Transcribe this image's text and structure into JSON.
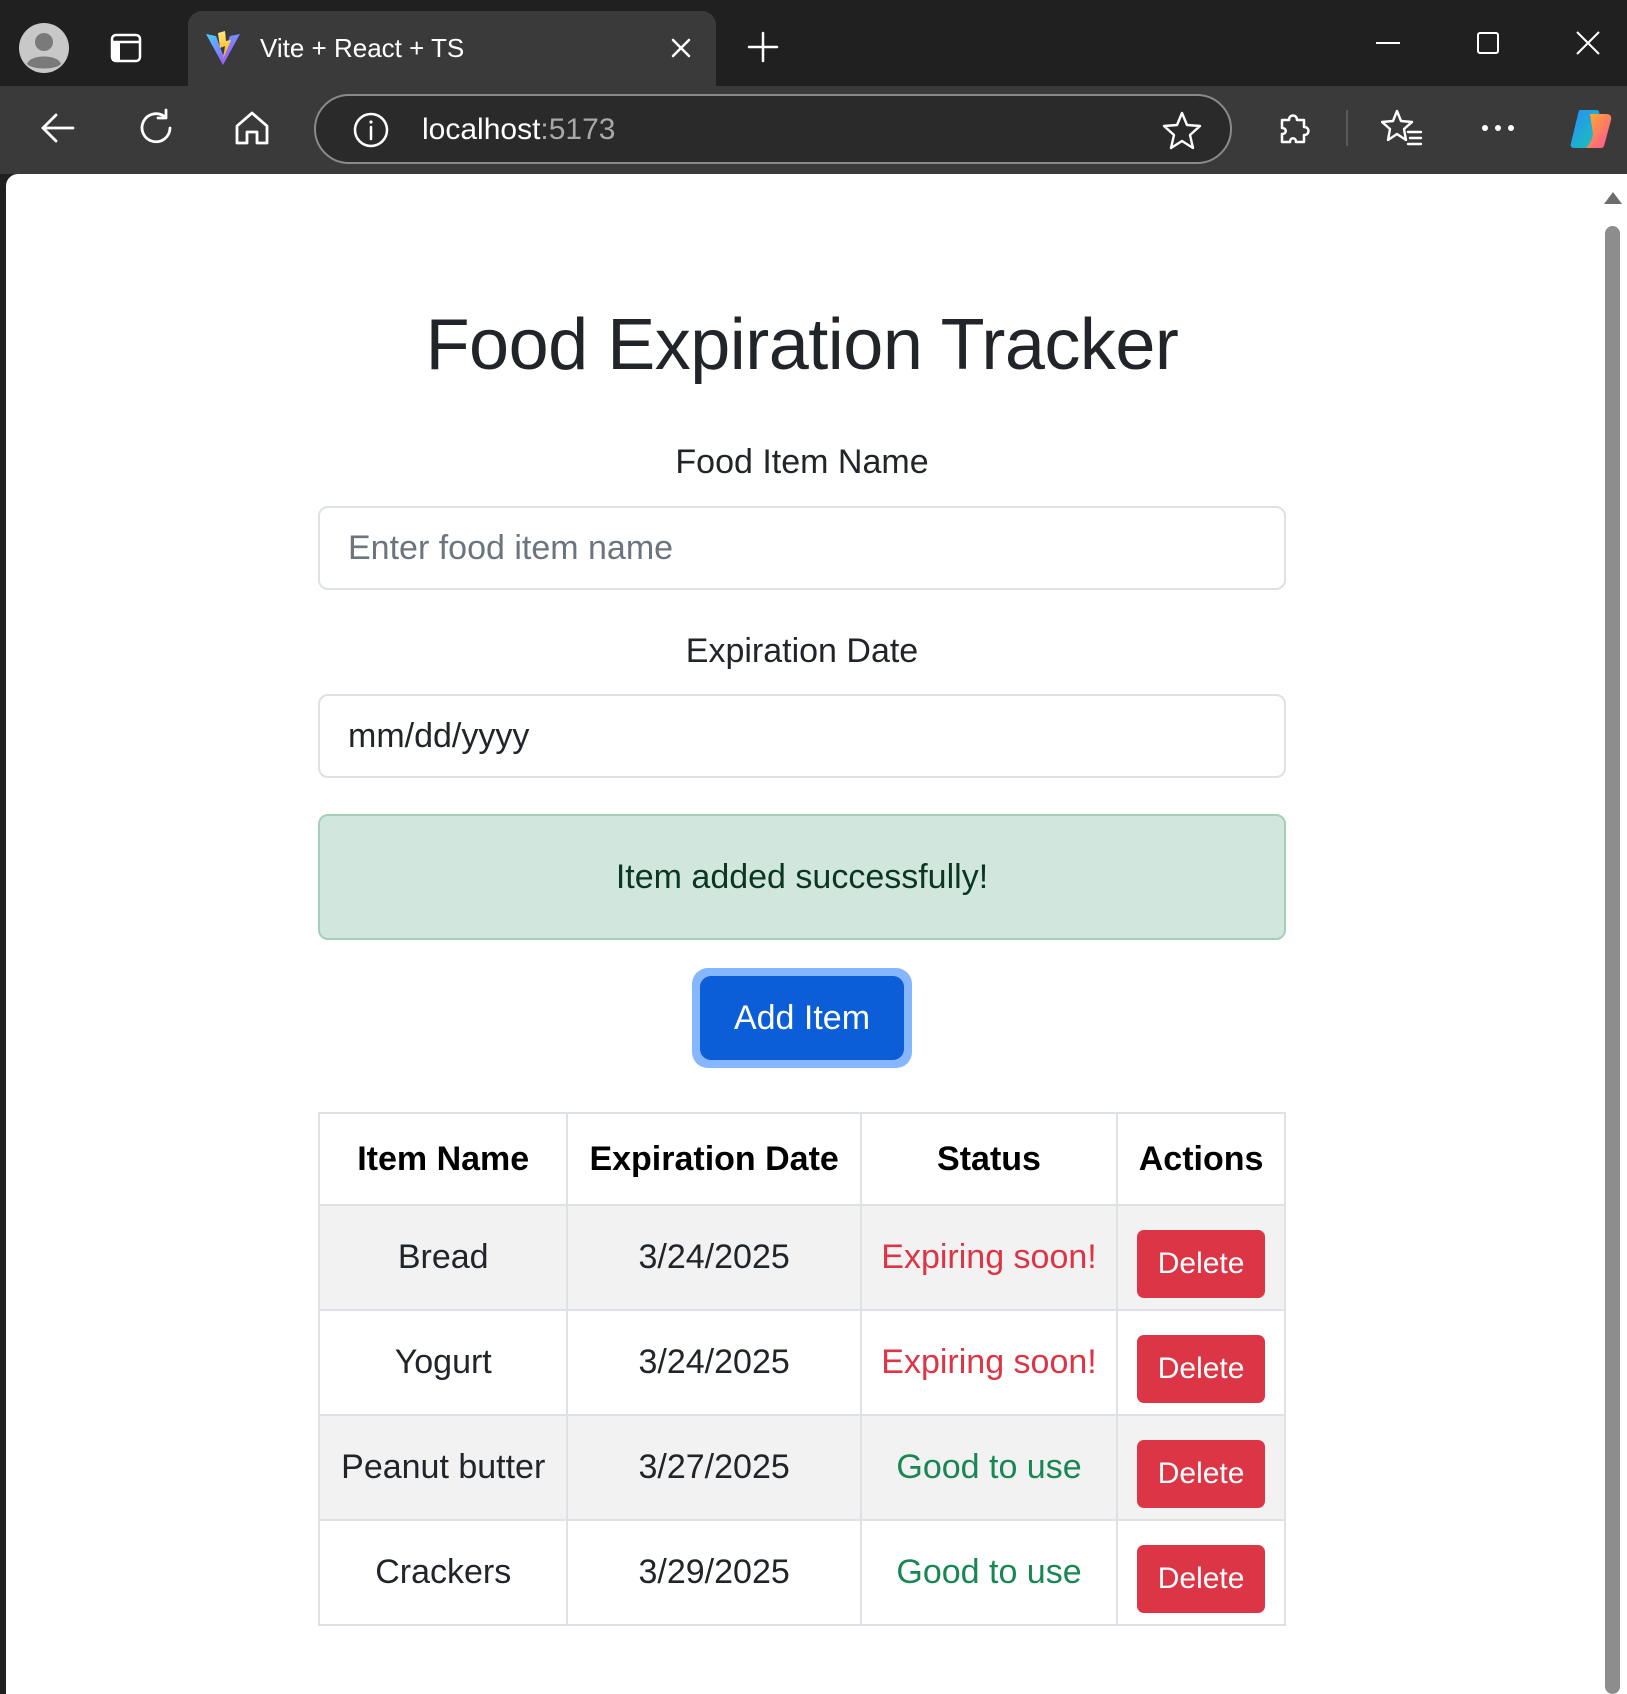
{
  "browser": {
    "tab_title": "Vite + React + TS",
    "address_host": "localhost",
    "address_port": ":5173"
  },
  "page": {
    "title": "Food Expiration Tracker",
    "form": {
      "name_label": "Food Item Name",
      "name_placeholder": "Enter food item name",
      "name_value": "",
      "date_label": "Expiration Date",
      "date_value": "mm/dd/yyyy",
      "add_button_label": "Add Item"
    },
    "alert": "Item added successfully!",
    "table": {
      "headers": [
        "Item Name",
        "Expiration Date",
        "Status",
        "Actions"
      ],
      "rows": [
        {
          "name": "Bread",
          "date": "3/24/2025",
          "status": "Expiring soon!",
          "action": "Delete"
        },
        {
          "name": "Yogurt",
          "date": "3/24/2025",
          "status": "Expiring soon!",
          "action": "Delete"
        },
        {
          "name": "Peanut butter",
          "date": "3/27/2025",
          "status": "Good to use",
          "action": "Delete"
        },
        {
          "name": "Crackers",
          "date": "3/29/2025",
          "status": "Good to use",
          "action": "Delete"
        }
      ]
    }
  },
  "colors": {
    "primary": "#0b5ed7",
    "danger": "#dc3545",
    "success": "#198754",
    "alert_bg": "#d1e7dd"
  },
  "icons": {
    "profile": "profile-icon",
    "tab_actions": "tab-actions-icon",
    "favicon": "vite-logo-icon",
    "close": "close-icon",
    "new_tab": "plus-icon",
    "back": "back-arrow-icon",
    "refresh": "refresh-icon",
    "home": "home-icon",
    "site_info": "info-icon",
    "favorite": "star-icon",
    "extensions": "puzzle-icon",
    "favorites": "favorites-icon",
    "more": "more-icon",
    "copilot": "copilot-icon"
  }
}
